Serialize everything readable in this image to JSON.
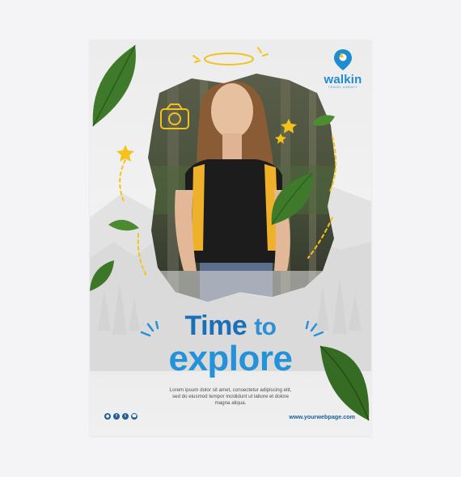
{
  "brand": {
    "name": "walkin",
    "tagline": "TRAVEL AGENCY",
    "color": "#1e8bd3"
  },
  "headline": {
    "line1": "Time",
    "line1_small": "to",
    "line2": "explore"
  },
  "body_text": "Lorem ipsum dolor sit amet, consectetur adipiscing elit, sed do eiusmod tempor incididunt ut labore et dolore magna aliqua.",
  "socials": [
    "instagram-icon",
    "facebook-icon",
    "twitter-icon",
    "whatsapp-icon"
  ],
  "website": "www.yourwebpage.com",
  "colors": {
    "headline": "#1a6fb8",
    "accent": "#f5c21b",
    "leaf": "#3f7a2a"
  }
}
